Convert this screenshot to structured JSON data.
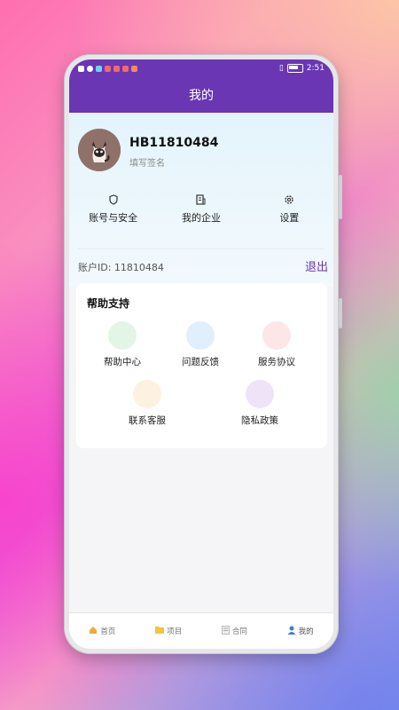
{
  "status_bar": {
    "time": "2:51"
  },
  "header": {
    "title": "我的"
  },
  "profile": {
    "username": "HB11810484",
    "signature": "填写签名"
  },
  "quick_actions": [
    {
      "label": "账号与安全",
      "icon": "shield-icon"
    },
    {
      "label": "我的企业",
      "icon": "building-icon"
    },
    {
      "label": "设置",
      "icon": "gear-icon"
    }
  ],
  "account": {
    "id_text": "账户ID:  11810484",
    "logout": "退出"
  },
  "help": {
    "title": "帮助支持",
    "items": [
      {
        "label": "帮助中心",
        "color": "#e3f5e6"
      },
      {
        "label": "问题反馈",
        "color": "#e1eefc"
      },
      {
        "label": "服务协议",
        "color": "#fde6e8"
      },
      {
        "label": "联系客服",
        "color": "#fdf1e0"
      },
      {
        "label": "隐私政策",
        "color": "#efe3f7"
      }
    ]
  },
  "bottom_nav": [
    {
      "label": "首页",
      "icon": "home-icon"
    },
    {
      "label": "项目",
      "icon": "folder-icon"
    },
    {
      "label": "合同",
      "icon": "contract-icon"
    },
    {
      "label": "我的",
      "icon": "user-icon"
    }
  ],
  "colors": {
    "primary": "#6a36b4"
  }
}
